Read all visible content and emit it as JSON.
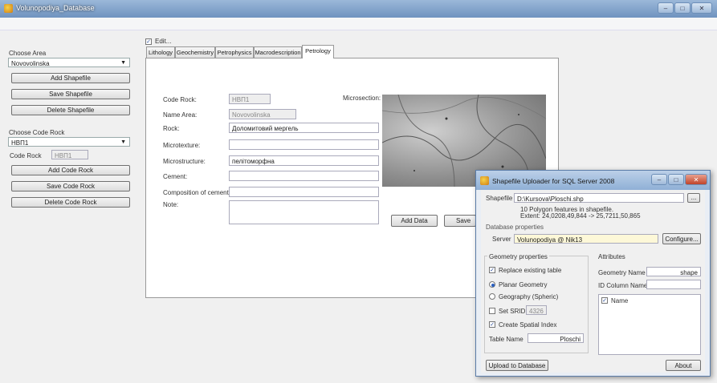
{
  "window": {
    "title": "Volunopodiya_Database"
  },
  "left": {
    "choose_area_label": "Choose Area",
    "area_value": "Novovolinska",
    "add_shapefile": "Add Shapefile",
    "save_shapefile": "Save Shapefile",
    "delete_shapefile": "Delete Shapefile",
    "choose_code_rock_label": "Choose Code Rock",
    "code_rock_value": "НВП1",
    "code_rock_label": "Code Rock",
    "code_rock_field": "НВП1",
    "add_code_rock": "Add Code Rock",
    "save_code_rock": "Save Code Rock",
    "delete_code_rock": "Delete Code Rock"
  },
  "edit": {
    "label": "Edit...",
    "checked": "✓"
  },
  "tabs": [
    "Lithology",
    "Geochemistry",
    "Petrophysics",
    "Macrodescription",
    "Petrology"
  ],
  "form": {
    "code_rock_label": "Code Rock:",
    "code_rock_value": "НВП1",
    "name_area_label": "Name Area:",
    "name_area_value": "Novovolinska",
    "rock_label": "Rock:",
    "rock_value": "Доломитовий мергель",
    "microtexture_label": "Microtexture:",
    "microtexture_value": "",
    "microstructure_label": "Microstructure:",
    "microstructure_value": "пелітоморфна",
    "cement_label": "Cement:",
    "cement_value": "",
    "composition_label": "Composition of cement:",
    "composition_value": "",
    "note_label": "Note:",
    "note_value": "",
    "microsection_label": "Microsection:",
    "add_data": "Add Data",
    "save_data": "Save D"
  },
  "dialog": {
    "title": "Shapefile Uploader for SQL Server 2008",
    "shapefile_label": "Shapefile",
    "shapefile_path": "D:\\Kursova\\Ploschi.shp",
    "browse": "...",
    "info_line1": "10 Polygon features in shapefile.",
    "info_line2": "Extent: 24,0208,49,844 -> 25,7211,50,865",
    "db_props": "Database properties",
    "server_label": "Server",
    "server_value": "Volunopodiya @ Nik13",
    "configure": "Configure...",
    "geom_props": "Geometry properties",
    "replace_table": "Replace existing table",
    "planar": "Planar Geometry",
    "geography": "Geography (Spheric)",
    "set_srid": "Set SRID",
    "srid_value": "4326",
    "spatial_index": "Create Spatial Index",
    "table_name_label": "Table Name",
    "table_name_value": "Ploschi",
    "attributes": "Attributes",
    "geometry_name_label": "Geometry Name",
    "geometry_name_value": "shape",
    "id_column_label": "ID Column Name",
    "id_column_value": "",
    "attr_name": "Name",
    "upload": "Upload to Database",
    "about": "About",
    "check": "✓"
  }
}
